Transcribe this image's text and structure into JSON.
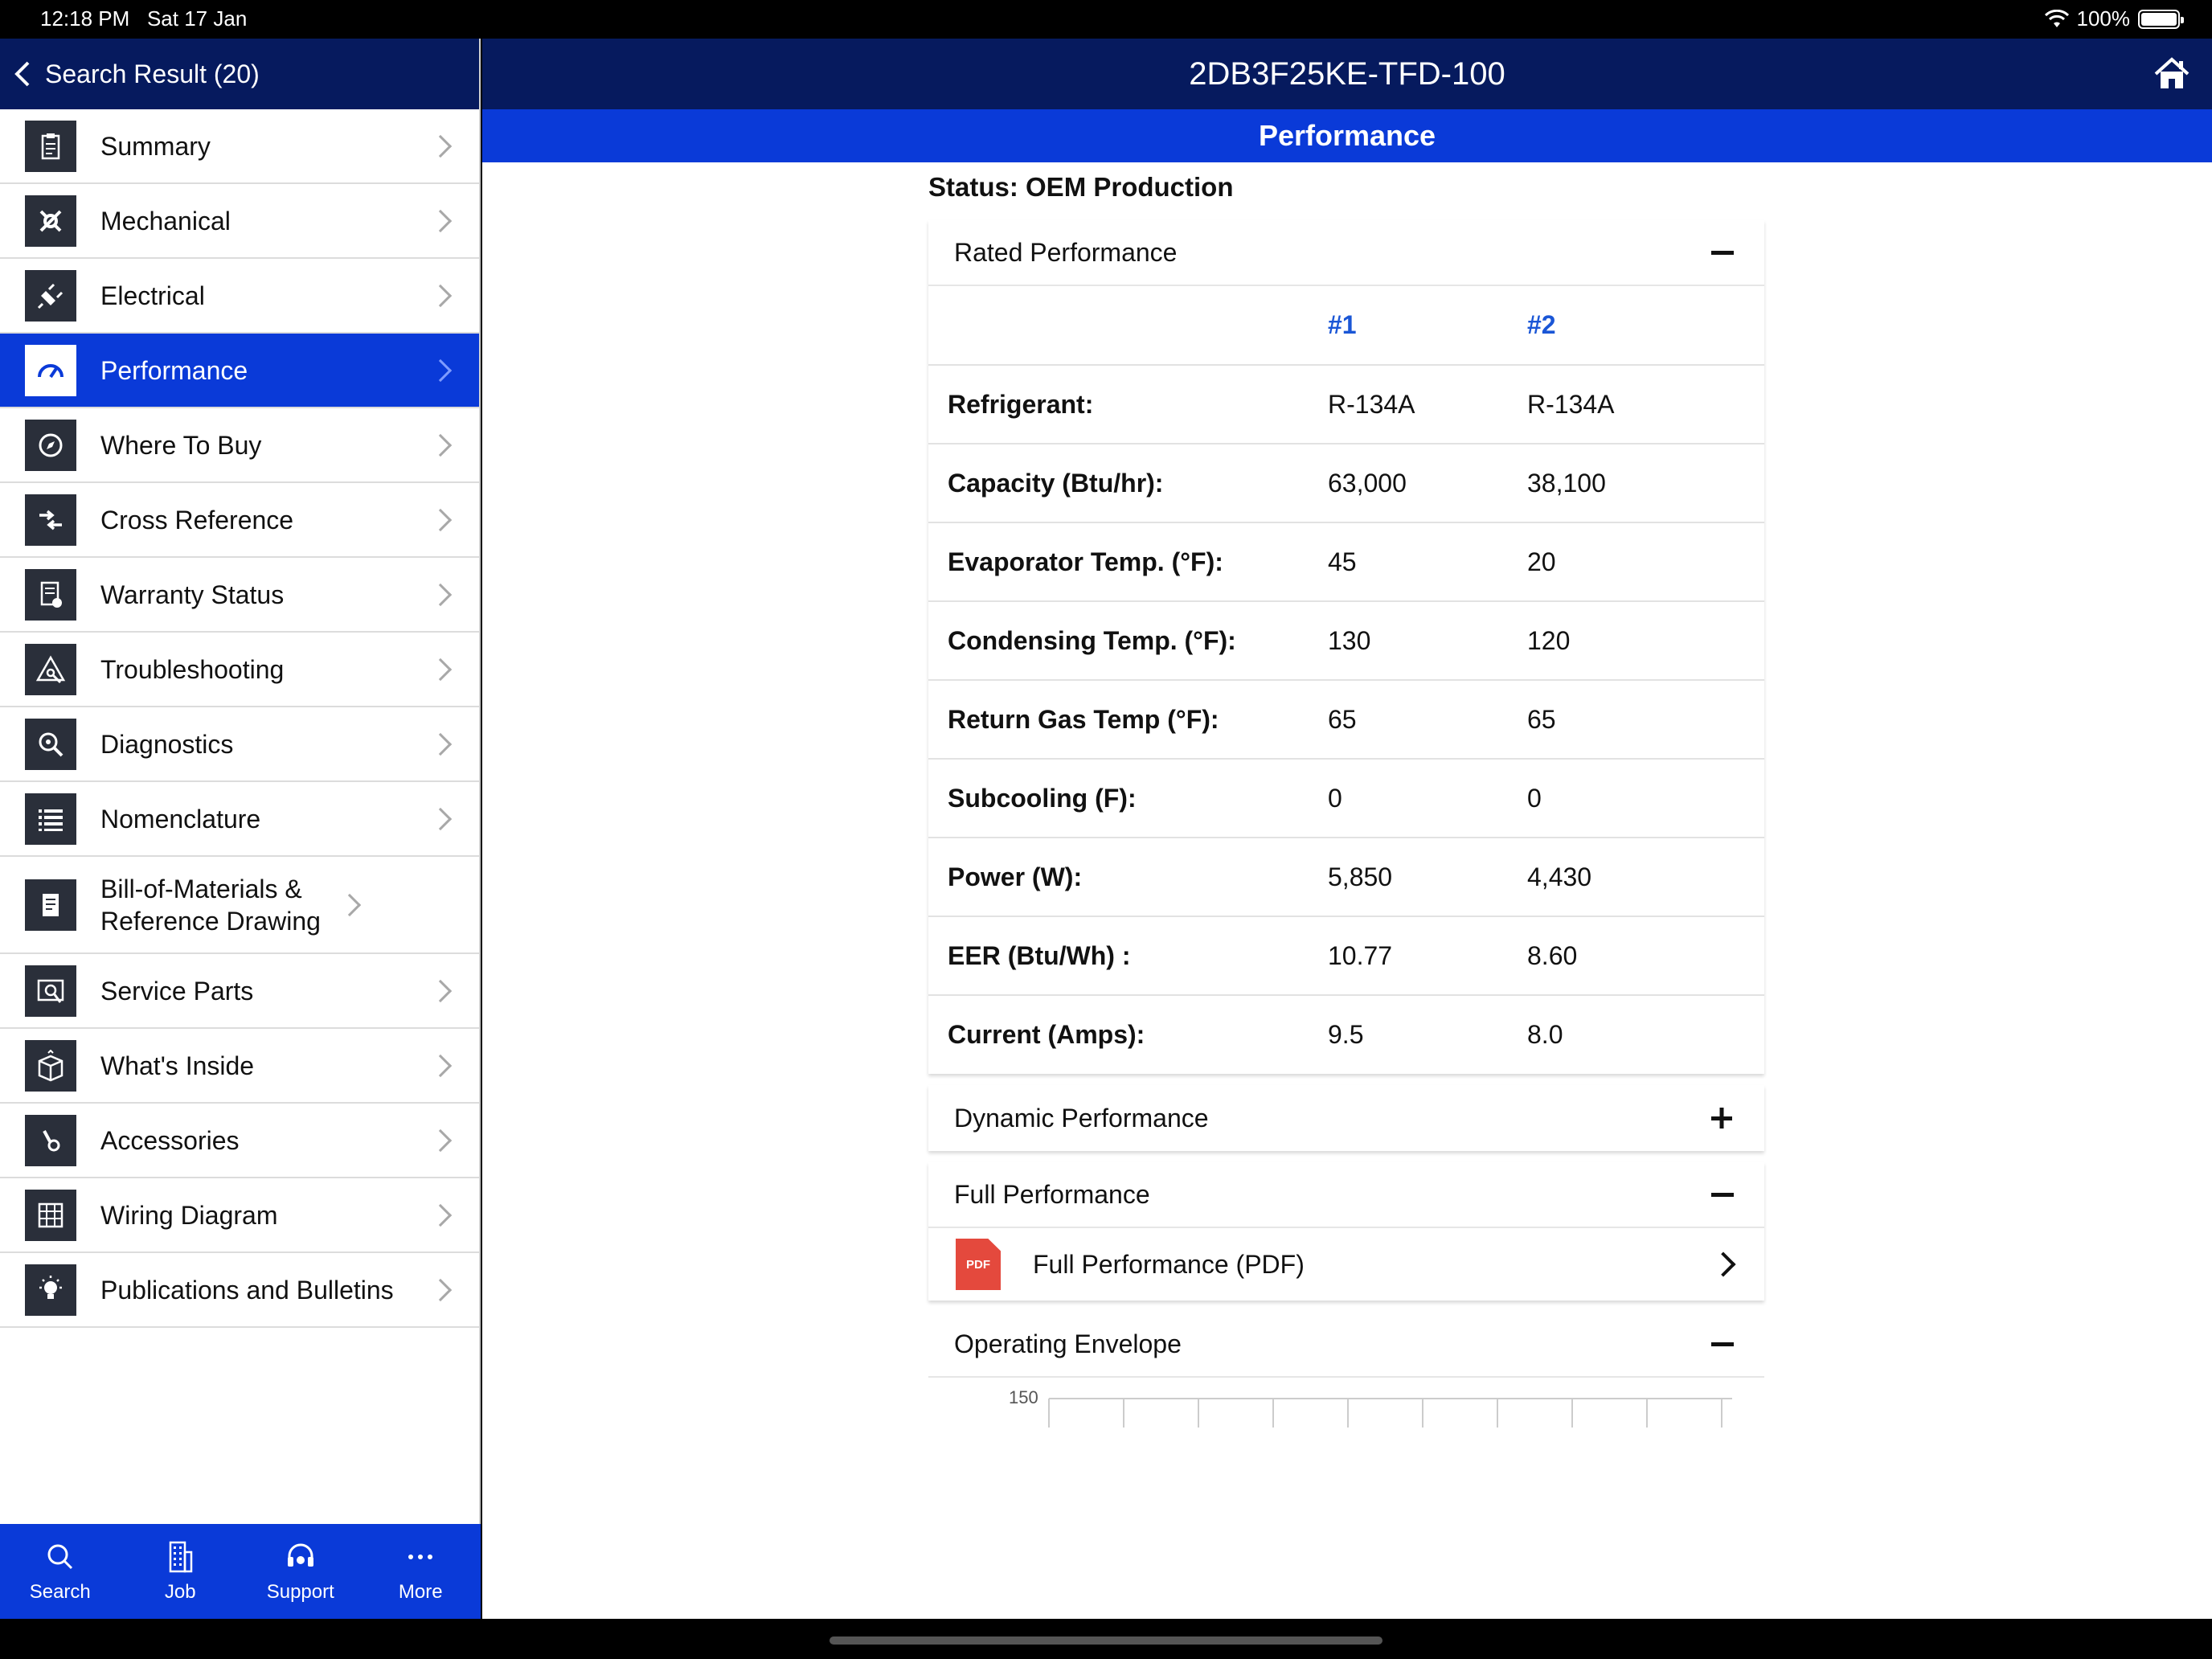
{
  "statusbar": {
    "time": "12:18 PM",
    "date": "Sat 17 Jan",
    "battery": "100%"
  },
  "sidebar": {
    "back_label": "Search Result (20)",
    "items": [
      {
        "label": "Summary",
        "icon": "clipboard-icon"
      },
      {
        "label": "Mechanical",
        "icon": "tools-icon"
      },
      {
        "label": "Electrical",
        "icon": "plug-icon"
      },
      {
        "label": "Performance",
        "icon": "gauge-icon"
      },
      {
        "label": "Where To Buy",
        "icon": "compass-icon"
      },
      {
        "label": "Cross Reference",
        "icon": "arrows-icon"
      },
      {
        "label": "Warranty Status",
        "icon": "certificate-icon"
      },
      {
        "label": "Troubleshooting",
        "icon": "warning-wrench-icon"
      },
      {
        "label": "Diagnostics",
        "icon": "magnifier-icon"
      },
      {
        "label": "Nomenclature",
        "icon": "list-icon"
      },
      {
        "label": "Bill-of-Materials & Reference Drawing",
        "icon": "document-icon"
      },
      {
        "label": "Service Parts",
        "icon": "parts-icon"
      },
      {
        "label": "What's Inside",
        "icon": "box-icon"
      },
      {
        "label": "Accessories",
        "icon": "accessory-icon"
      },
      {
        "label": "Wiring Diagram",
        "icon": "circuit-icon"
      },
      {
        "label": "Publications and Bulletins",
        "icon": "lightbulb-icon"
      }
    ],
    "active": "Performance"
  },
  "tabbar": [
    {
      "label": "Search",
      "icon": "search-icon"
    },
    {
      "label": "Job",
      "icon": "building-icon"
    },
    {
      "label": "Support",
      "icon": "headset-icon"
    },
    {
      "label": "More",
      "icon": "more-icon"
    }
  ],
  "header": {
    "title": "2DB3F25KE-TFD-100",
    "subtitle": "Performance"
  },
  "status": "Status: OEM Production",
  "rated": {
    "title": "Rated Performance",
    "columns": [
      "#1",
      "#2"
    ],
    "rows": [
      {
        "k": "Refrigerant:",
        "v1": "R-134A",
        "v2": "R-134A"
      },
      {
        "k": "Capacity (Btu/hr):",
        "v1": "63,000",
        "v2": "38,100"
      },
      {
        "k": "Evaporator Temp. (°F):",
        "v1": "45",
        "v2": "20"
      },
      {
        "k": "Condensing Temp. (°F):",
        "v1": "130",
        "v2": "120"
      },
      {
        "k": "Return Gas Temp (°F):",
        "v1": "65",
        "v2": "65"
      },
      {
        "k": "Subcooling (F):",
        "v1": "0",
        "v2": "0"
      },
      {
        "k": "Power (W):",
        "v1": "5,850",
        "v2": "4,430"
      },
      {
        "k": "EER (Btu/Wh) :",
        "v1": "10.77",
        "v2": "8.60"
      },
      {
        "k": "Current (Amps):",
        "v1": "9.5",
        "v2": "8.0"
      }
    ]
  },
  "dynamic": {
    "title": "Dynamic Performance",
    "toggle": "+"
  },
  "full": {
    "title": "Full Performance",
    "pdf_label": "Full Performance (PDF)",
    "pdf_badge": "PDF"
  },
  "envelope": {
    "title": "Operating Envelope",
    "y_tick": "150"
  },
  "colors": {
    "navy": "#061a5e",
    "blue": "#0a3ad8",
    "link": "#1a56d6",
    "pdf": "#e4493d"
  }
}
